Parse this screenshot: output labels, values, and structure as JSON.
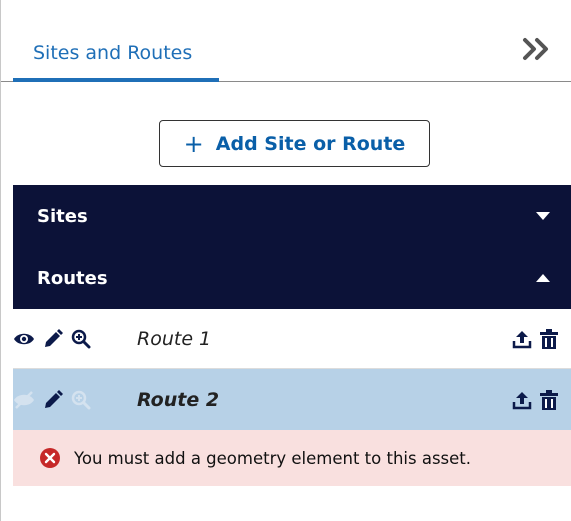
{
  "tabs": [
    {
      "label": "Sites and Routes",
      "active": true
    }
  ],
  "collapse_icon": "double-chevron-right-icon",
  "add_button": {
    "label": "Add Site or Route",
    "icon": "plus-icon"
  },
  "sections": [
    {
      "title": "Sites",
      "expanded": false,
      "icon": "caret-down-icon"
    },
    {
      "title": "Routes",
      "expanded": true,
      "icon": "caret-up-icon"
    }
  ],
  "routes": [
    {
      "name": "Route 1",
      "visible": true,
      "selected": false
    },
    {
      "name": "Route 2",
      "visible": false,
      "selected": true
    }
  ],
  "error": {
    "message": "You must add a geometry element to this asset.",
    "icon": "error-circle-icon"
  },
  "colors": {
    "accent": "#1f6fb7",
    "header_bg": "#0c1238",
    "selected_row": "#b7d1e7",
    "error_bg": "#f9e0df",
    "error_icon": "#c62828"
  }
}
